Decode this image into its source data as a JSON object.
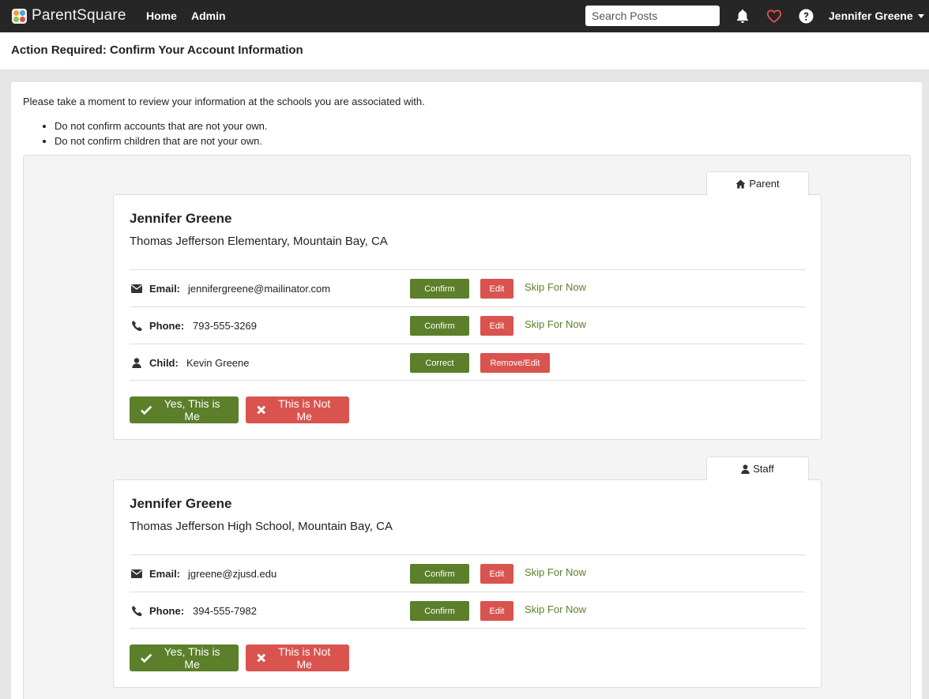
{
  "nav": {
    "brand": "ParentSquare",
    "links": [
      "Home",
      "Admin"
    ],
    "search_placeholder": "Search Posts",
    "user_name": "Jennifer Greene"
  },
  "header": {
    "title": "Action Required: Confirm Your Account Information"
  },
  "intro": {
    "text": "Please take a moment to review your information at the schools you are associated with.",
    "bullets": [
      "Do not confirm accounts that are not your own.",
      "Do not confirm children that are not your own."
    ]
  },
  "cards": [
    {
      "role": "Parent",
      "name": "Jennifer Greene",
      "school": "Thomas Jefferson Elementary, Mountain Bay, CA",
      "rows": [
        {
          "label": "Email:",
          "value": "jennifergreene@mailinator.com",
          "primary": "Confirm",
          "secondary": "Edit",
          "skip": "Skip For Now"
        },
        {
          "label": "Phone:",
          "value": "793-555-3269",
          "primary": "Confirm",
          "secondary": "Edit",
          "skip": "Skip For Now"
        },
        {
          "label": "Child:",
          "value": "Kevin Greene",
          "primary": "Correct",
          "secondary": "Remove/Edit"
        }
      ],
      "yes_label": "Yes, This is Me",
      "no_label": "This is Not Me"
    },
    {
      "role": "Staff",
      "name": "Jennifer Greene",
      "school": "Thomas Jefferson High School, Mountain Bay, CA",
      "rows": [
        {
          "label": "Email:",
          "value": "jgreene@zjusd.edu",
          "primary": "Confirm",
          "secondary": "Edit",
          "skip": "Skip For Now"
        },
        {
          "label": "Phone:",
          "value": "394-555-7982",
          "primary": "Confirm",
          "secondary": "Edit",
          "skip": "Skip For Now"
        }
      ],
      "yes_label": "Yes, This is Me",
      "no_label": "This is Not Me"
    }
  ],
  "colors": {
    "nav_bg": "#262626",
    "green": "#5b7f2a",
    "red": "#d9534f",
    "heart": "#e0524c"
  }
}
